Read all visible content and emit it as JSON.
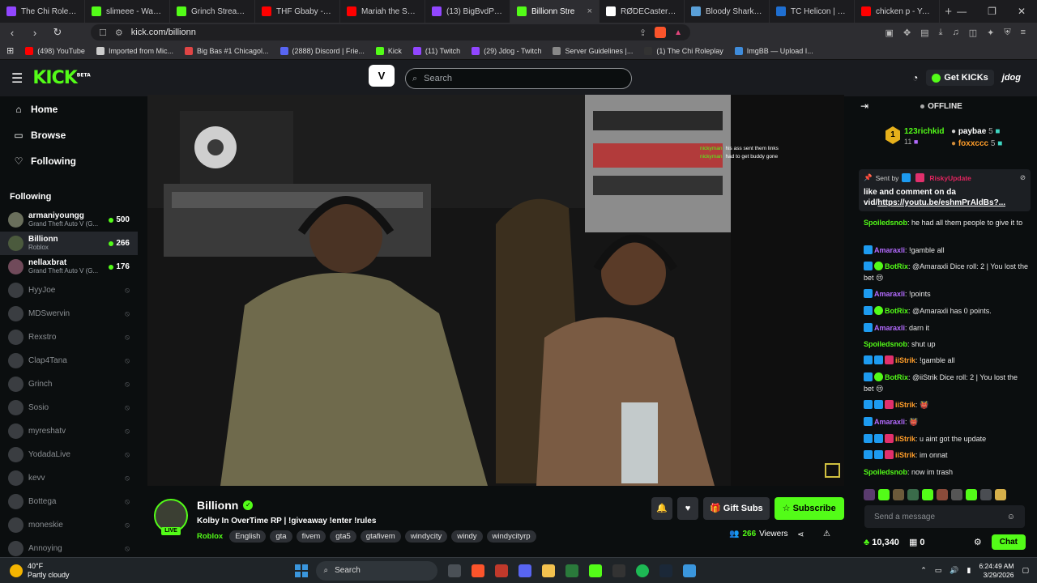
{
  "browser": {
    "tabs": [
      {
        "label": "The Chi Roleplay",
        "color": "#9146ff"
      },
      {
        "label": "slimeee - Watch clip",
        "color": "#53fc18"
      },
      {
        "label": "Grinch Stream - Wa",
        "color": "#53fc18"
      },
      {
        "label": "THF Gbaby - SCOO",
        "color": "#ff0000"
      },
      {
        "label": "Mariah the Scientist",
        "color": "#ff0000"
      },
      {
        "label": "(13) BigBvdPretty",
        "color": "#9146ff"
      },
      {
        "label": "Billionn Stre",
        "color": "#53fc18",
        "active": true
      },
      {
        "label": "RØDECaster Pro | Pc",
        "color": "#ffffff"
      },
      {
        "label": "Bloody Shark Crazy",
        "color": "#5aa0d8"
      },
      {
        "label": "TC Helicon | Produc",
        "color": "#1f6fd1"
      },
      {
        "label": "chicken p - YouTub",
        "color": "#ff0000"
      }
    ],
    "url": "kick.com/billionn",
    "bookmarks": [
      {
        "label": "(498) YouTube",
        "color": "#ff0000"
      },
      {
        "label": "Imported from Mic...",
        "color": "#cccccc"
      },
      {
        "label": "Big Bas #1 Chicagol...",
        "color": "#e04545"
      },
      {
        "label": "(2888) Discord | Frie...",
        "color": "#5865f2"
      },
      {
        "label": "Kick",
        "color": "#53fc18"
      },
      {
        "label": "(11) Twitch",
        "color": "#9146ff"
      },
      {
        "label": "(29) Jdog - Twitch",
        "color": "#9146ff"
      },
      {
        "label": "Server Guidelines |...",
        "color": "#888888"
      },
      {
        "label": "(1) The Chi Roleplay",
        "color": "#333333"
      },
      {
        "label": "ImgBB — Upload I...",
        "color": "#3f8cdb"
      }
    ]
  },
  "header": {
    "logo": "KICK",
    "logo_sup": "BETA",
    "search_placeholder": "Search",
    "get_kicks": "Get KICKs",
    "clip_icon": "V"
  },
  "sidebar": {
    "nav": [
      {
        "label": "Home",
        "icon": "home-icon"
      },
      {
        "label": "Browse",
        "icon": "browse-icon"
      },
      {
        "label": "Following",
        "icon": "heart-icon"
      }
    ],
    "following_title": "Following",
    "live": [
      {
        "name": "armaniyoungg",
        "game": "Grand Theft Auto V (G...",
        "viewers": "500"
      },
      {
        "name": "Billionn",
        "game": "Roblox",
        "viewers": "266",
        "selected": true
      },
      {
        "name": "nellaxbrat",
        "game": "Grand Theft Auto V (G...",
        "viewers": "176"
      }
    ],
    "offline": [
      "HyyJoe",
      "MDSwervin",
      "Rexstro",
      "Clap4Tana",
      "Grinch",
      "Sosio",
      "myreshatv",
      "YodadaLive",
      "kevv",
      "Bottega",
      "moneskie",
      "Annoying"
    ]
  },
  "video": {
    "overlay_chat": [
      {
        "user": "nickyman",
        "text": "his ass sent them links"
      },
      {
        "user": "nickyman",
        "text": "had to get buddy gone"
      }
    ]
  },
  "stream": {
    "name": "Billionn",
    "title": "Kolby In OverTime RP | !giveaway !enter !rules",
    "category": "Roblox",
    "tags": [
      "English",
      "gta",
      "fivem",
      "gta5",
      "gtafivem",
      "windycity",
      "windy",
      "windycityrp"
    ],
    "live_label": "LIVE",
    "gift_subs": "Gift Subs",
    "subscribe": "Subscribe",
    "viewers": "266",
    "viewers_label": "Viewers"
  },
  "chat": {
    "status": "OFFLINE",
    "leaderboard": {
      "rank": "1",
      "top": {
        "name": "123richkid",
        "score": "11"
      },
      "second": {
        "name": "paybae",
        "score": "5"
      },
      "third": {
        "name": "foxxccc",
        "score": "5"
      }
    },
    "pinned": {
      "sent_by": "Sent by",
      "sender": "RiskyUpdate",
      "text": "like and comment on da vid/",
      "link": "https://youtu.be/eshmPrAldBs?..."
    },
    "messages": [
      {
        "user": "Spoiledsnob",
        "color": "#53fc18",
        "text": "he had all them people to give it to",
        "badges": []
      },
      {
        "user": "Amaraxli",
        "color": "#b46bff",
        "text": "!gamble all",
        "badges": [
          "b1"
        ]
      },
      {
        "user": "BotRix",
        "color": "#53fc18",
        "text": "@Amaraxli Dice roll: 2 | You lost the bet 😢",
        "badges": [
          "b1",
          "b2"
        ]
      },
      {
        "user": "Amaraxli",
        "color": "#b46bff",
        "text": "!points",
        "badges": [
          "b1"
        ]
      },
      {
        "user": "BotRix",
        "color": "#53fc18",
        "text": "@Amaraxli has 0 points.",
        "badges": [
          "b1",
          "b2"
        ]
      },
      {
        "user": "Amaraxli",
        "color": "#b46bff",
        "text": "darn it",
        "badges": [
          "b1"
        ]
      },
      {
        "user": "Spoiledsnob",
        "color": "#53fc18",
        "text": "shut up",
        "badges": []
      },
      {
        "user": "iiStrik",
        "color": "#ff9d2a",
        "text": "!gamble all",
        "badges": [
          "b1",
          "b1",
          "b3"
        ]
      },
      {
        "user": "BotRix",
        "color": "#53fc18",
        "text": "@iiStrik Dice roll: 2 | You lost the bet 😢",
        "badges": [
          "b1",
          "b2"
        ]
      },
      {
        "user": "iiStrik",
        "color": "#ff9d2a",
        "text": "👹",
        "badges": [
          "b1",
          "b1",
          "b3"
        ]
      },
      {
        "user": "Amaraxli",
        "color": "#b46bff",
        "text": "👹",
        "badges": [
          "b1"
        ]
      },
      {
        "user": "iiStrik",
        "color": "#ff9d2a",
        "text": "u aint got the update",
        "badges": [
          "b1",
          "b1",
          "b3"
        ]
      },
      {
        "user": "iiStrik",
        "color": "#ff9d2a",
        "text": "im onnat",
        "badges": [
          "b1",
          "b1",
          "b3"
        ]
      },
      {
        "user": "Spoiledsnob",
        "color": "#53fc18",
        "text": "now im trash",
        "badges": []
      }
    ],
    "placeholder": "Send a message",
    "points": "10,340",
    "gifts": "0",
    "send": "Chat"
  },
  "taskbar": {
    "temp": "40°F",
    "weather": "Partly cloudy",
    "search": "Search",
    "time": "6:24:49 AM",
    "date": "3/29/2026"
  }
}
